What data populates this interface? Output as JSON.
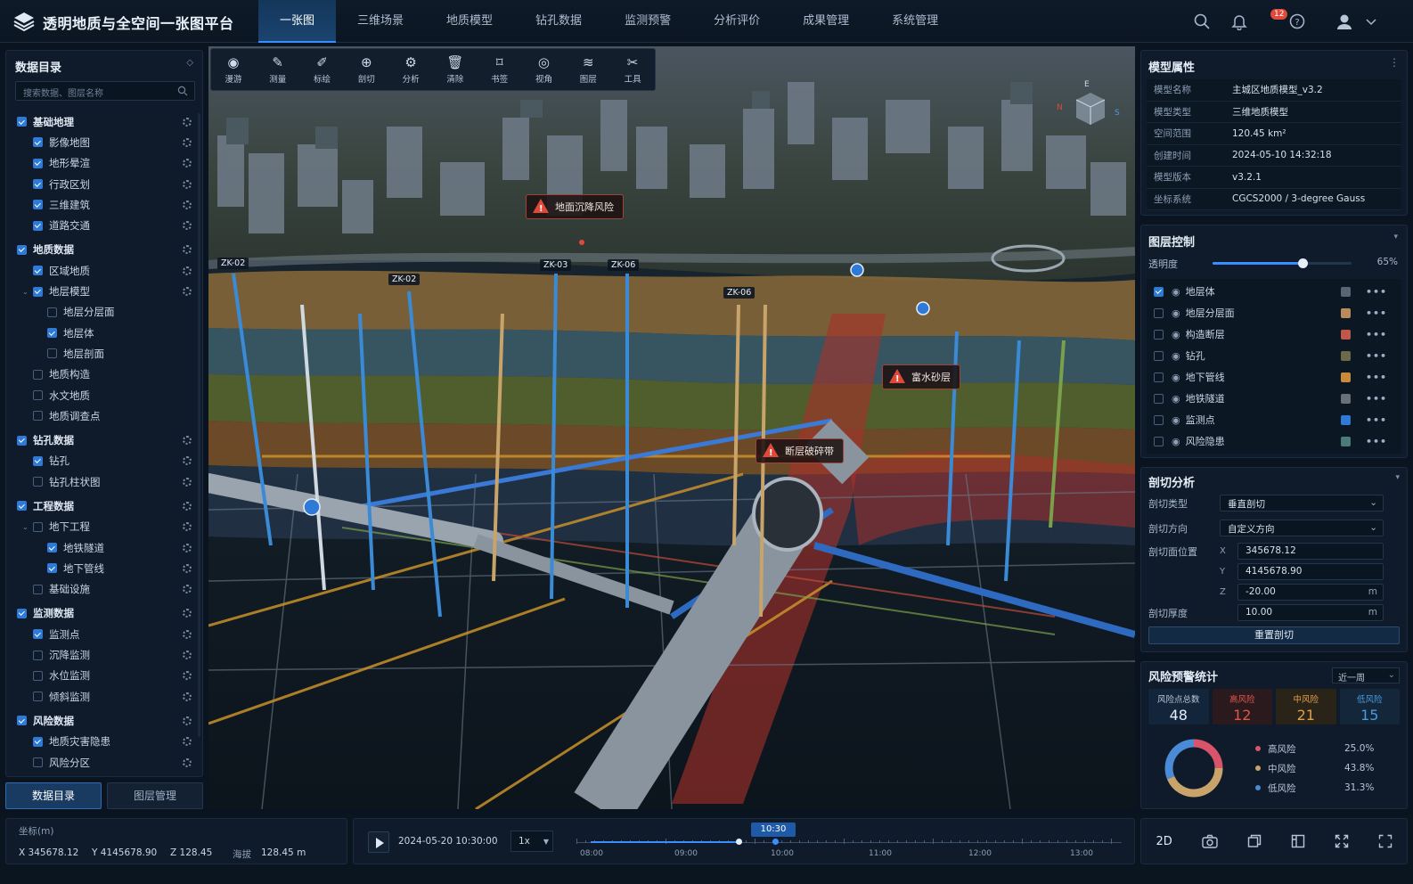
{
  "app": {
    "title": "透明地质与全空间一张图平台"
  },
  "nav": [
    "一张图",
    "三维场景",
    "地质模型",
    "钻孔数据",
    "监测预警",
    "分析评价",
    "成果管理",
    "系统管理"
  ],
  "notifications": {
    "count": "12"
  },
  "left": {
    "title": "数据目录",
    "search_placeholder": "搜索数据、图层名称",
    "tree": [
      {
        "label": "基础地理",
        "level": 0,
        "checked": true,
        "header": true,
        "gear": true
      },
      {
        "label": "影像地图",
        "level": 1,
        "checked": true,
        "gear": true
      },
      {
        "label": "地形晕渲",
        "level": 1,
        "checked": true,
        "gear": true
      },
      {
        "label": "行政区划",
        "level": 1,
        "checked": true,
        "gear": true
      },
      {
        "label": "三维建筑",
        "level": 1,
        "checked": true,
        "gear": true
      },
      {
        "label": "道路交通",
        "level": 1,
        "checked": true,
        "gear": true
      },
      {
        "label": "地质数据",
        "level": 0,
        "checked": true,
        "header": true,
        "gear": true
      },
      {
        "label": "区域地质",
        "level": 1,
        "checked": true,
        "gear": true
      },
      {
        "label": "地层模型",
        "level": 1,
        "checked": true,
        "gear": true,
        "expand": true
      },
      {
        "label": "地层分层面",
        "level": 2,
        "checked": false
      },
      {
        "label": "地层体",
        "level": 2,
        "checked": true
      },
      {
        "label": "地层剖面",
        "level": 2,
        "checked": false
      },
      {
        "label": "地质构造",
        "level": 1,
        "checked": false
      },
      {
        "label": "水文地质",
        "level": 1,
        "checked": false
      },
      {
        "label": "地质调查点",
        "level": 1,
        "checked": false
      },
      {
        "label": "钻孔数据",
        "level": 0,
        "checked": true,
        "header": true,
        "gear": true
      },
      {
        "label": "钻孔",
        "level": 1,
        "checked": true,
        "gear": true
      },
      {
        "label": "钻孔柱状图",
        "level": 1,
        "checked": false,
        "gear": true
      },
      {
        "label": "工程数据",
        "level": 0,
        "checked": true,
        "header": true,
        "gear": true
      },
      {
        "label": "地下工程",
        "level": 1,
        "checked": false,
        "gear": true,
        "expand": true
      },
      {
        "label": "地铁隧道",
        "level": 2,
        "checked": true,
        "gear": true
      },
      {
        "label": "地下管线",
        "level": 2,
        "checked": true,
        "gear": true
      },
      {
        "label": "基础设施",
        "level": 1,
        "checked": false,
        "gear": true
      },
      {
        "label": "监测数据",
        "level": 0,
        "checked": true,
        "header": true,
        "gear": true
      },
      {
        "label": "监测点",
        "level": 1,
        "checked": true,
        "gear": true
      },
      {
        "label": "沉降监测",
        "level": 1,
        "checked": false,
        "gear": true
      },
      {
        "label": "水位监测",
        "level": 1,
        "checked": false,
        "gear": true
      },
      {
        "label": "倾斜监测",
        "level": 1,
        "checked": false,
        "gear": true
      },
      {
        "label": "风险数据",
        "level": 0,
        "checked": true,
        "header": true,
        "gear": true
      },
      {
        "label": "地质灾害隐患",
        "level": 1,
        "checked": true,
        "gear": true
      },
      {
        "label": "风险分区",
        "level": 1,
        "checked": false,
        "gear": true
      }
    ],
    "tabs": [
      "数据目录",
      "图层管理"
    ]
  },
  "toolbar": [
    {
      "label": "漫游",
      "icon": "◉"
    },
    {
      "label": "测量",
      "icon": "✎"
    },
    {
      "label": "标绘",
      "icon": "✐"
    },
    {
      "label": "剖切",
      "icon": "⊕"
    },
    {
      "label": "分析",
      "icon": "⚙"
    },
    {
      "label": "清除",
      "icon": "🗑"
    },
    {
      "label": "书签",
      "icon": "⌑"
    },
    {
      "label": "视角",
      "icon": "◎"
    },
    {
      "label": "图层",
      "icon": "≋"
    },
    {
      "label": "工具",
      "icon": "✂"
    }
  ],
  "scene": {
    "boreholes": [
      "ZK-02",
      "ZK-02",
      "ZK-03",
      "ZK-06",
      "ZK-06"
    ],
    "tags": [
      "地面沉降风险",
      "富水砂层",
      "断层破碎带"
    ],
    "compass": {
      "e": "E",
      "n": "N",
      "s": "S"
    }
  },
  "model": {
    "title": "模型属性",
    "props": [
      {
        "k": "模型名称",
        "v": "主城区地质模型_v3.2"
      },
      {
        "k": "模型类型",
        "v": "三维地质模型"
      },
      {
        "k": "空间范围",
        "v": "120.45 km²"
      },
      {
        "k": "创建时间",
        "v": "2024-05-10 14:32:18"
      },
      {
        "k": "模型版本",
        "v": "v3.2.1"
      },
      {
        "k": "坐标系统",
        "v": "CGCS2000 / 3-degree Gauss"
      }
    ]
  },
  "layers": {
    "title": "图层控制",
    "opacity_label": "透明度",
    "opacity": "65%",
    "opacity_value": 0.65,
    "items": [
      {
        "label": "地层体",
        "checked": true,
        "color": "#5a6472"
      },
      {
        "label": "地层分层面",
        "checked": false,
        "color": "#b98a5a"
      },
      {
        "label": "构造断层",
        "checked": false,
        "color": "#c0574a"
      },
      {
        "label": "钻孔",
        "checked": false,
        "color": "#6b6a4a"
      },
      {
        "label": "地下管线",
        "checked": false,
        "color": "#c98a3a"
      },
      {
        "label": "地铁隧道",
        "checked": false,
        "color": "#6a7078"
      },
      {
        "label": "监测点",
        "checked": false,
        "color": "#2e7ad6"
      },
      {
        "label": "风险隐患",
        "checked": false,
        "color": "#4a7a7a"
      }
    ]
  },
  "section": {
    "title": "剖切分析",
    "type_label": "剖切类型",
    "type_value": "垂直剖切",
    "dir_label": "剖切方向",
    "dir_value": "自定义方向",
    "pos_label": "剖切面位置",
    "x": "345678.12",
    "y": "4145678.90",
    "z": "-20.00",
    "unit": "m",
    "thick_label": "剖切厚度",
    "thick_value": "10.00",
    "reset": "重置剖切"
  },
  "risk": {
    "title": "风险预警统计",
    "period": "近一周",
    "cards": [
      {
        "label": "风险点总数",
        "value": "48",
        "color": "#e6eef8"
      },
      {
        "label": "高风险",
        "value": "12",
        "color": "#e0574a"
      },
      {
        "label": "中风险",
        "value": "21",
        "color": "#e0a04a"
      },
      {
        "label": "低风险",
        "value": "15",
        "color": "#4a9ae0"
      }
    ],
    "legend": [
      {
        "label": "高风险",
        "pct": "25.0%",
        "color": "#d8546a",
        "value": 25.0
      },
      {
        "label": "中风险",
        "pct": "43.8%",
        "color": "#c9a46a",
        "value": 43.8
      },
      {
        "label": "低风险",
        "pct": "31.3%",
        "color": "#4a8ad6",
        "value": 31.3
      }
    ]
  },
  "coords": {
    "title": "坐标(m)",
    "x": "X  345678.12",
    "y": "Y  4145678.90",
    "z": "Z  128.45",
    "alt_label": "海拔",
    "alt": "128.45 m"
  },
  "timeline": {
    "datetime": "2024-05-20 10:30:00",
    "speed": "1x",
    "current": "10:30",
    "ticks": [
      "08:00",
      "09:00",
      "10:00",
      "11:00",
      "12:00",
      "13:00"
    ]
  },
  "viewtools": {
    "mode": "2D"
  }
}
